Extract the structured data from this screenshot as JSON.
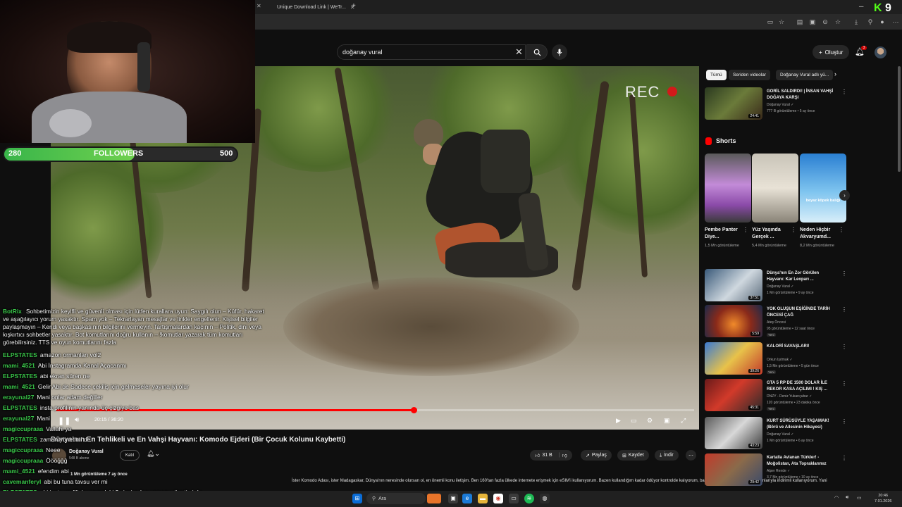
{
  "browser": {
    "tabs": [
      {
        "label": "Unique Download Link | WeTr..."
      }
    ],
    "overlay_counter": "9",
    "overlay_logo_letter": "K"
  },
  "youtube": {
    "search": {
      "value": "doğanay vural",
      "placeholder": "Ara"
    },
    "create_label": "Oluştur",
    "notifications_count": "3",
    "video": {
      "rec_label": "REC",
      "progress": 0.56,
      "time": "20:15 / 36:20",
      "title": "Dünya'nın En Tehlikeli ve En Vahşi Hayvanı: Komodo Ejderi (Bir Çocuk Kolunu Kaybetti)",
      "channel": "Doğanay Vural",
      "subs": "548 B abone",
      "join_label": "Katıl",
      "likes": "31 B",
      "share_label": "Paylaş",
      "save_label": "Kaydet",
      "download_label": "İndir",
      "desc_meta": "1 Mn görüntüleme 7 ay önce",
      "desc_text": "İster Komodo Adası, ister Madagaskar, Dünya'nın neresinde olursan ol, en önemli konu iletişim. Ben 160'tan fazla ülkede internete erişmek için eSIM'i kullanıyorum.    Bazen kullandığım kadar ödüyor kontrolde kalıyorum, bazen de ülke bazlı süreli veri planlarıyla indirimli kullanıyorum. Yani"
    },
    "chips": [
      {
        "label": "Tümü",
        "active": true
      },
      {
        "label": "Seriden videolar",
        "active": false
      },
      {
        "label": "Doğanay Vural adlı yü...",
        "active": false
      }
    ],
    "shorts_heading": "Shorts",
    "shorts": [
      {
        "title": "Pembe Panter Diye...",
        "views": "1,5 Mn görüntüleme"
      },
      {
        "title": "Yüz Yaşında Gerçek ...",
        "views": "5,4 Mn görüntüleme"
      },
      {
        "title": "Neden Hiçbir Akvaryumd...",
        "views": "8,2 Mn görüntüleme",
        "overlay": "beyaz köpek balığı"
      }
    ],
    "recommendations": [
      {
        "title": "GORİL SALDIRDI! | İNSAN VAHŞİ DOĞAYA KARŞI",
        "channel": "Doğanay Vural ✓",
        "meta": "777 B görüntüleme • 5 ay önce",
        "duration": "24:41",
        "new": ""
      },
      {
        "title": "Dünya'nın En Zor Görülen Hayvanı: Kar Leoparı ...",
        "channel": "Doğanay Vural ✓",
        "meta": "1 Mn görüntüleme • 9 ay önce",
        "duration": "37:51",
        "new": ""
      },
      {
        "title": "YOK OLUŞUN EŞİĞİNDE TARİH ÖNCESİ ÇAĞ",
        "channel": "Ateş Öncesi",
        "meta": "95 görüntüleme • 12 saat önce",
        "duration": "5:59",
        "new": "Yeni"
      },
      {
        "title": "KALORİ SAVAŞLARI!",
        "channel": "Orkun Işıtmak ✓",
        "meta": "1,5 Mn görüntüleme • 5 gün önce",
        "duration": "39:26",
        "new": "Yeni"
      },
      {
        "title": "GTA 5 RP DE 1500 DOLAR İLE REKOR KASA AÇILIMI ! KIŞ ...",
        "channel": "DNZY - Deniz Yukarıçubar ✓",
        "meta": "120 görüntüleme • 23 dakika önce",
        "duration": "45:31",
        "new": "Yeni"
      },
      {
        "title": "KURT SÜRÜSÜYLE YAŞAMAK! (Börü ve Ailesinin Hikayesi)",
        "channel": "Doğanay Vural ✓",
        "meta": "1 Mn görüntüleme • 6 ay önce",
        "duration": "43:23",
        "new": ""
      },
      {
        "title": "Kartalla Avlanan Türkler! - Moğolistan, Ata Topraklarımız",
        "channel": "Alper Rende ✓",
        "meta": "3,7 Mn görüntüleme • 10 ay önce",
        "duration": "29:42",
        "new": ""
      }
    ]
  },
  "stream": {
    "followers": {
      "current": "280",
      "label": "FOLLOWERS",
      "goal": "500",
      "fraction": 0.56
    },
    "bot": {
      "user": "BotRix",
      "text": "Sohbetimizin keyifli ve güvenli olması için lütfen kurallara uyun: Saygılı olun – Küfür, hakaret ve aşağılayıcı yorum yasaktır. Spam yok – Tekrarlayan mesajlar ve linkler engellenir. Kişisel bilgiler paylaşmayın – Kendi veya başkasının bilgilerini vermeyin. Tartışmalardan kaçının – Politik, dini veya kışkırtıcı sohbetler yasaktır. Bot komutlarını doğru kullanın – !komutlar yazarak tüm komutları görebilirsiniz. TTS ve oyun komutlarını fazla"
    },
    "chat": [
      {
        "user": "ELPSTATES",
        "color": "#3ac74a",
        "text": "amazon ormanları vol2"
      },
      {
        "user": "mami_4521",
        "color": "#3ac74a",
        "text": "Abi İnstagramda Kanal Açacanmı"
      },
      {
        "user": "ELPSTATES",
        "color": "#3ac74a",
        "text": "abi ekran süren ne"
      },
      {
        "user": "mami_4521",
        "color": "#3ac74a",
        "text": "Gelir Abi de Sadece çekiliş için gelmeseler yayına iyi olur"
      },
      {
        "user": "erayunal27",
        "color": "#3ac74a",
        "text": "Mani onlar adam değiller"
      },
      {
        "user": "ELPSTATES",
        "color": "#3ac74a",
        "text": "insta profilinin yanında üç çizgiye bas"
      },
      {
        "user": "erayunal27",
        "color": "#3ac74a",
        "text": "Mani"
      },
      {
        "user": "magiccupraaa",
        "color": "#3ac74a",
        "text": "Vallahi ya"
      },
      {
        "user": "ELPSTATES",
        "color": "#3ac74a",
        "text": "zaman yönetimi de"
      },
      {
        "user": "magiccupraaa",
        "color": "#3ac74a",
        "text": "Neee"
      },
      {
        "user": "magiccupraaa",
        "color": "#3ac74a",
        "text": "Öööğğğ"
      },
      {
        "user": "mami_4521",
        "color": "#3ac74a",
        "text": "efendim abi"
      },
      {
        "user": "cavemanferyl",
        "color": "#3ac74a",
        "text": "abi bu tuna tavsu ver mi"
      },
      {
        "user": "ELPSTATES",
        "color": "#3ac74a",
        "text": "abi insta profilinin yanındaki 3 çizgiye bas zaman yönetimi de"
      }
    ]
  },
  "taskbar": {
    "search_label": "Ara",
    "time": "20:46",
    "date": "7.01.2026"
  }
}
